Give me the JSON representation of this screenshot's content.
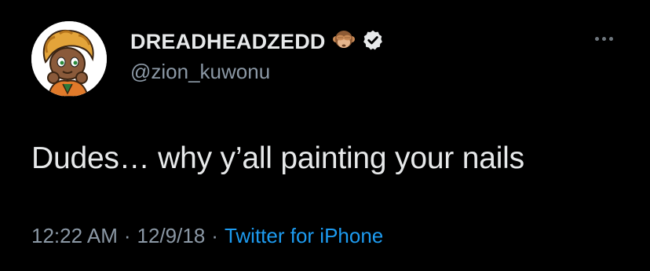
{
  "tweet": {
    "display_name": "DREADHEADZEDD",
    "handle": "@zion_kuwonu",
    "text": "Dudes… why y’all painting your nails",
    "time": "12:22 AM",
    "date": "12/9/18",
    "separator": "·",
    "source": "Twitter for iPhone"
  },
  "icons": {
    "name_emoji": "see-no-evil-monkey-icon",
    "verified": "verified-badge-icon",
    "more": "more-options-icon"
  },
  "colors": {
    "background": "#000000",
    "primary_text": "#e7e9ea",
    "secondary_text": "#8b98a5",
    "link": "#1d9bf0"
  }
}
